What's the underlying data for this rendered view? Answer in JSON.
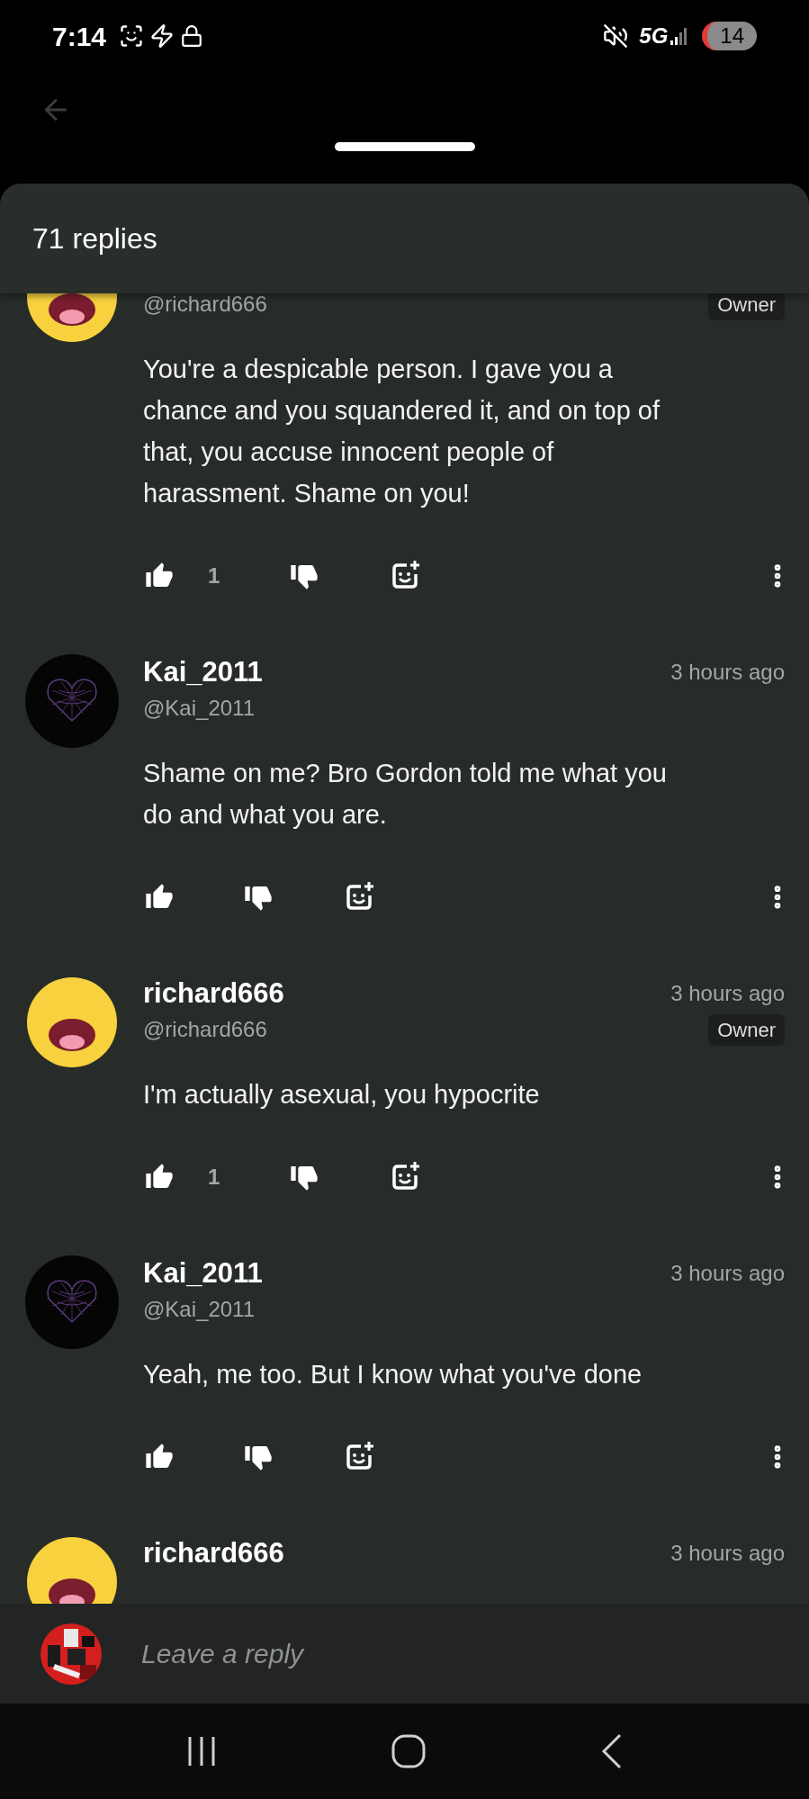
{
  "status_bar": {
    "time": "7:14",
    "network": "5G",
    "battery": "14"
  },
  "sheet": {
    "title": "71 replies"
  },
  "comments": [
    {
      "avatar": {
        "kind": "smiley"
      },
      "handle": "@richard666",
      "badge": "Owner",
      "text": "You're a despicable person. I gave you a chance and you squandered it, and on top of that, you accuse innocent people of harassment. Shame on you!",
      "likes": "1"
    },
    {
      "avatar": {
        "kind": "web"
      },
      "name": "Kai_2011",
      "time": "3 hours ago",
      "handle": "@Kai_2011",
      "text": "Shame on me? Bro Gordon told me what you do and what you are."
    },
    {
      "avatar": {
        "kind": "smiley"
      },
      "name": "richard666",
      "time": "3 hours ago",
      "handle": "@richard666",
      "badge": "Owner",
      "text": "I'm actually asexual, you hypocrite",
      "likes": "1"
    },
    {
      "avatar": {
        "kind": "web"
      },
      "name": "Kai_2011",
      "time": "3 hours ago",
      "handle": "@Kai_2011",
      "text": "Yeah, me too. But I know what you've done"
    },
    {
      "avatar": {
        "kind": "smiley"
      },
      "name": "richard666",
      "time": "3 hours ago"
    }
  ],
  "reply_field": {
    "placeholder": "Leave a reply"
  }
}
